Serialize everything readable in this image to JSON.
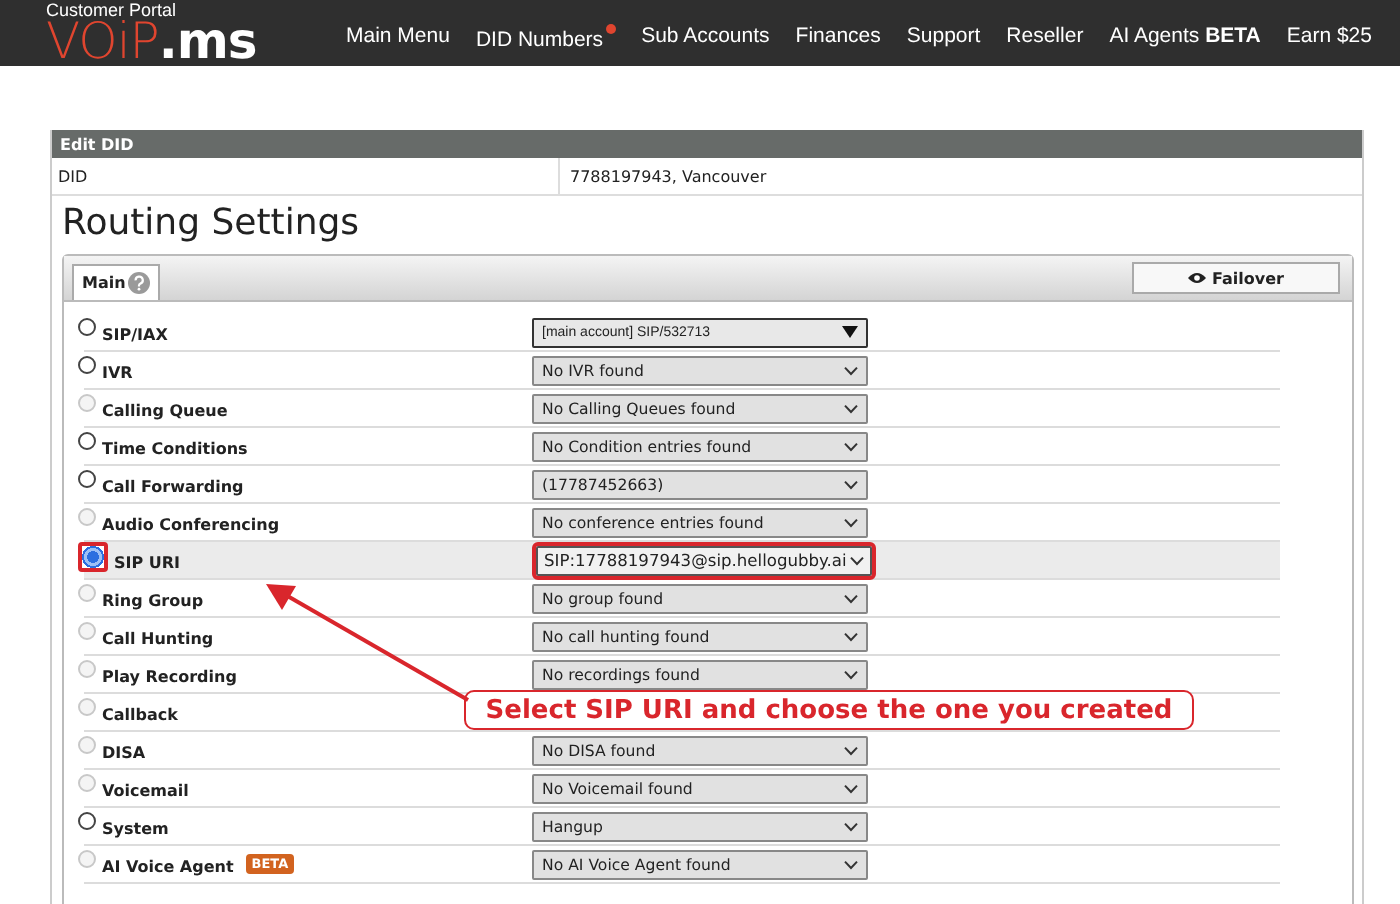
{
  "header": {
    "portal_label": "Customer Portal",
    "logo": {
      "primary": "VOiP",
      "secondary": ".ms"
    },
    "nav": [
      {
        "label": "Main Menu",
        "badge": false
      },
      {
        "label": "DID Numbers",
        "badge": true
      },
      {
        "label": "Sub Accounts",
        "badge": false
      },
      {
        "label": "Finances",
        "badge": false
      },
      {
        "label": "Support",
        "badge": false
      },
      {
        "label": "Reseller",
        "badge": false
      },
      {
        "label": "AI Agents **BETA**",
        "badge": false
      },
      {
        "label": "Earn $25",
        "badge": false
      }
    ]
  },
  "edit_did": {
    "title": "Edit DID",
    "field_label": "DID",
    "field_value": "7788197943, Vancouver"
  },
  "routing": {
    "title": "Routing Settings",
    "tabs": [
      {
        "label": "Main",
        "selected": true
      }
    ],
    "failover_button": "Failover",
    "rows": [
      {
        "label": "SIP/IAX",
        "selected": false,
        "disabled": false,
        "kind": "combo",
        "value": "[main account] SIP/532713",
        "outlined": false
      },
      {
        "label": "IVR",
        "selected": false,
        "disabled": false,
        "kind": "dropdown",
        "value": "No IVR found",
        "outlined": false
      },
      {
        "label": "Calling Queue",
        "selected": false,
        "disabled": true,
        "kind": "dropdown",
        "value": "No Calling Queues found",
        "outlined": false
      },
      {
        "label": "Time Conditions",
        "selected": false,
        "disabled": false,
        "kind": "dropdown",
        "value": "No Condition entries found",
        "outlined": false
      },
      {
        "label": "Call Forwarding",
        "selected": false,
        "disabled": false,
        "kind": "dropdown",
        "value": "(17787452663)",
        "outlined": false
      },
      {
        "label": "Audio Conferencing",
        "selected": false,
        "disabled": true,
        "kind": "dropdown",
        "value": "No conference entries found",
        "outlined": false
      },
      {
        "label": "SIP URI",
        "selected": true,
        "disabled": false,
        "kind": "dropdown",
        "value": "SIP:17788197943@sip.hellogubby.ai",
        "outlined": true
      },
      {
        "label": "Ring Group",
        "selected": false,
        "disabled": true,
        "kind": "dropdown",
        "value": "No group found",
        "outlined": false
      },
      {
        "label": "Call Hunting",
        "selected": false,
        "disabled": true,
        "kind": "dropdown",
        "value": "No call hunting found",
        "outlined": false
      },
      {
        "label": "Play Recording",
        "selected": false,
        "disabled": true,
        "kind": "dropdown",
        "value": "No recordings found",
        "outlined": false
      },
      {
        "label": "Callback",
        "selected": false,
        "disabled": true,
        "outlined": false
      },
      {
        "label": "DISA",
        "selected": false,
        "disabled": true,
        "kind": "dropdown",
        "value": "No DISA found",
        "outlined": false
      },
      {
        "label": "Voicemail",
        "selected": false,
        "disabled": true,
        "kind": "dropdown",
        "value": "No Voicemail found",
        "outlined": false
      },
      {
        "label": "System",
        "selected": false,
        "disabled": false,
        "kind": "dropdown",
        "value": "Hangup",
        "outlined": false
      },
      {
        "label": "AI Voice Agent",
        "badge": "BETA",
        "selected": false,
        "disabled": true,
        "kind": "dropdown",
        "value": "No AI Voice Agent found",
        "outlined": false
      }
    ]
  },
  "annotation": {
    "callout": "Select SIP URI and choose the one you created"
  }
}
